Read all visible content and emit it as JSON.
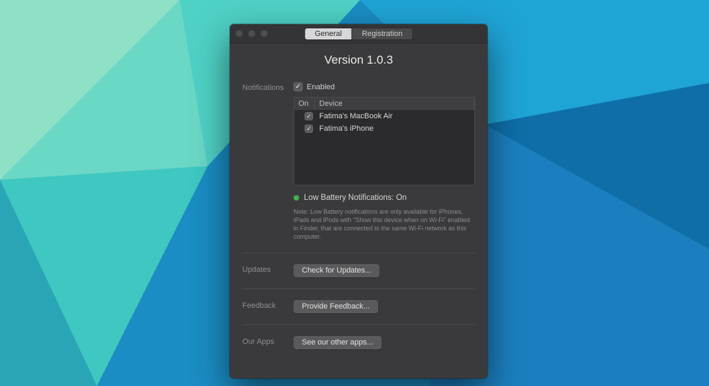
{
  "tabs": {
    "general": "General",
    "registration": "Registration"
  },
  "version_line": "Version 1.0.3",
  "sections": {
    "notifications": {
      "label": "Notifications",
      "enabled_label": "Enabled",
      "enabled": true,
      "table": {
        "col_on": "On",
        "col_device": "Device",
        "rows": [
          {
            "on": true,
            "device": "Fatima's MacBook Air"
          },
          {
            "on": true,
            "device": "Fatima's iPhone"
          }
        ]
      },
      "status": "Low Battery Notifications: On",
      "status_color": "#3fb04f",
      "note": "Note: Low Battery notifications are only available for iPhones, iPads and iPods with \"Show this device when on Wi-Fi\" enabled in Finder, that are connected to the same Wi-Fi network as this computer."
    },
    "updates": {
      "label": "Updates",
      "button": "Check for Updates..."
    },
    "feedback": {
      "label": "Feedback",
      "button": "Provide Feedback..."
    },
    "ourapps": {
      "label": "Our Apps",
      "button": "See our other apps..."
    }
  }
}
